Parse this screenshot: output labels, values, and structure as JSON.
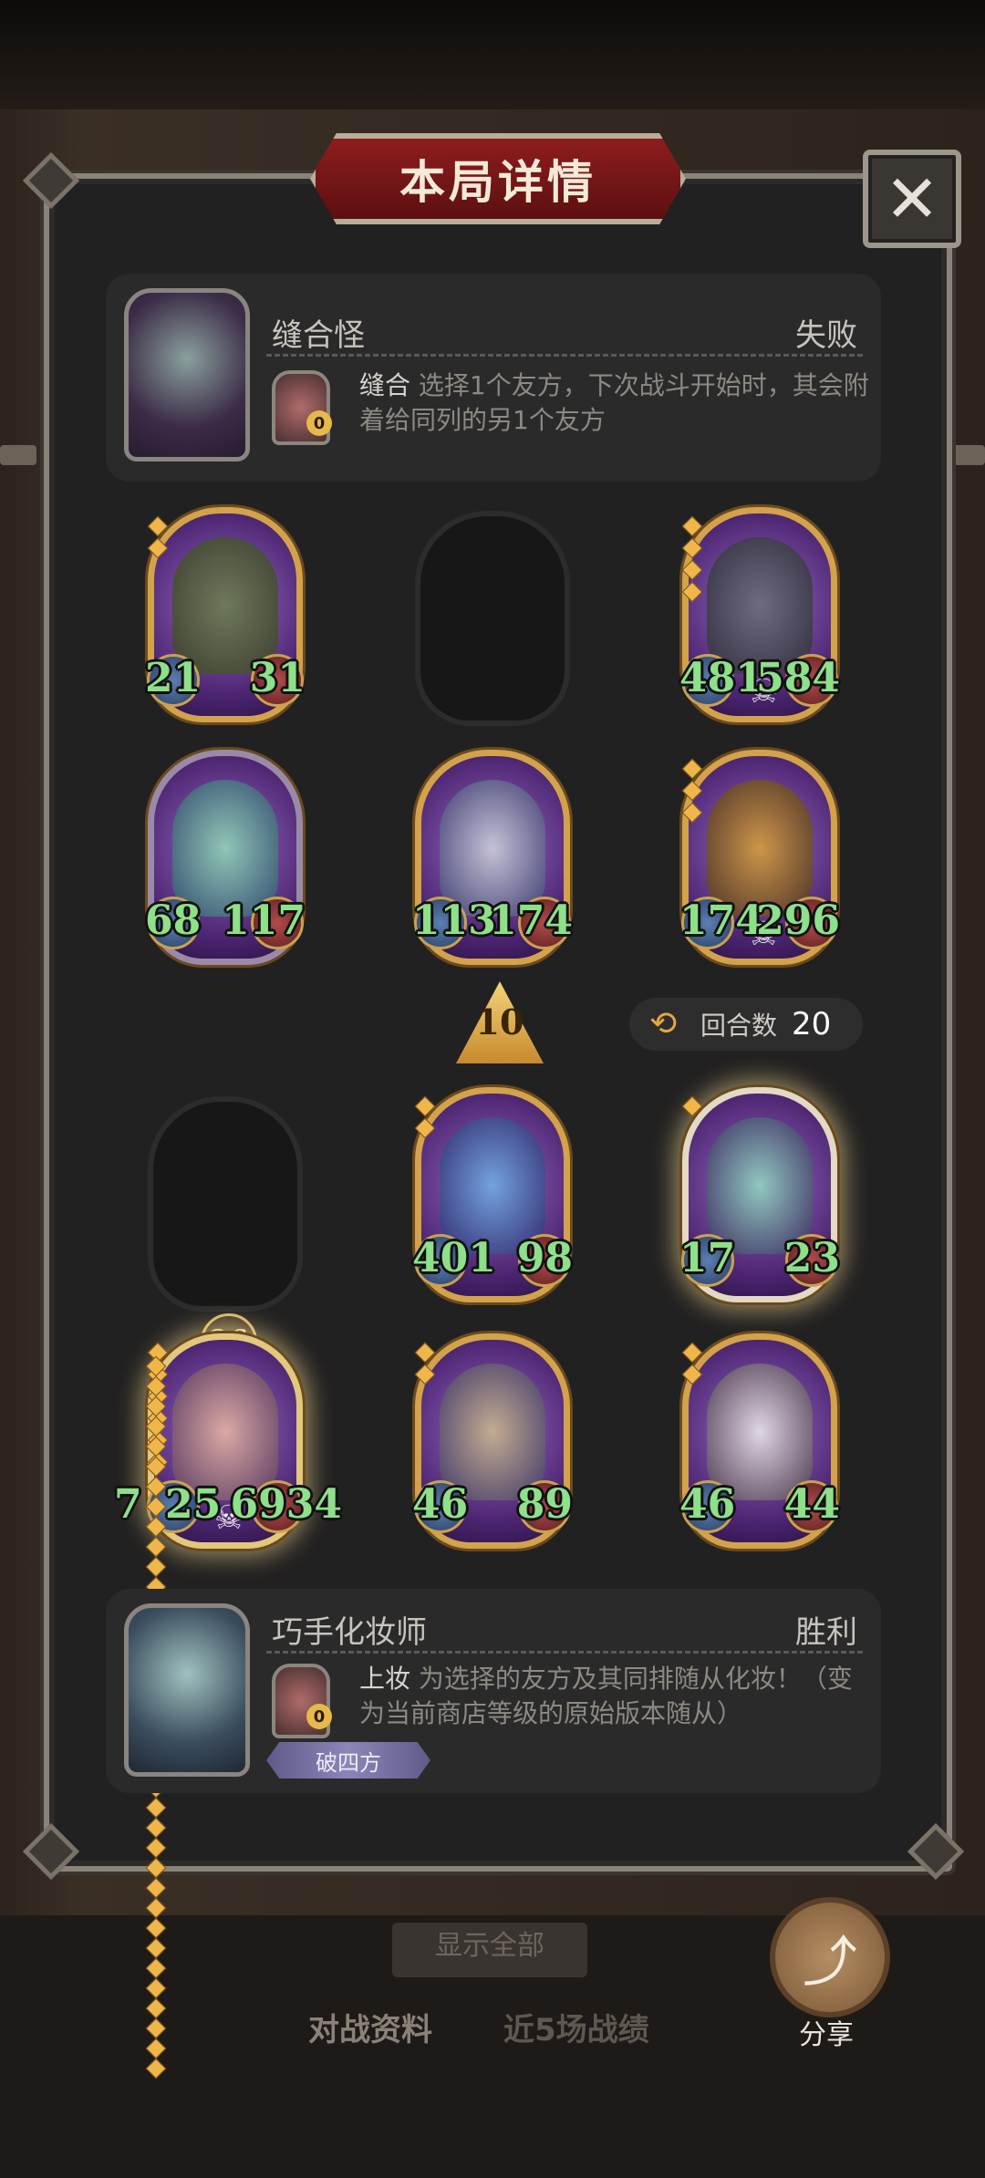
{
  "title": "本局详情",
  "close_label": "✕",
  "opponent": {
    "name": "缝合怪",
    "result": "失败",
    "hero_power_cost": "0",
    "power_name": "缝合",
    "power_desc": "选择1个友方，下次战斗开始时，其会附着给同列的另1个友方"
  },
  "player": {
    "name": "巧手化妆师",
    "result": "胜利",
    "hero_power_cost": "0",
    "power_name": "上妆",
    "power_desc": "为选择的友方及其同排随从化妆！（变为当前商店等级的原始版本随从）",
    "tag": "破四方"
  },
  "opponent_board": [
    {
      "attack": "21",
      "health": "31"
    },
    null,
    {
      "attack": "481",
      "health": "584"
    },
    {
      "attack": "68",
      "health": "117"
    },
    {
      "attack": "113",
      "health": "174"
    },
    {
      "attack": "174",
      "health": "296"
    }
  ],
  "player_board": [
    null,
    {
      "attack": "401",
      "health": "98"
    },
    {
      "attack": "17",
      "health": "23"
    },
    {
      "attack": "7",
      "health": "6934"
    },
    {
      "attack": "46",
      "health": "89"
    },
    {
      "attack": "46",
      "health": "44"
    }
  ],
  "center_stat": "25",
  "level": "10",
  "turn": {
    "label": "回合数",
    "value": "20"
  },
  "tier_badge": "26",
  "bottom": {
    "show_all": "显示全部",
    "tab_battle": "对战资料",
    "tab_recent": "近5场战绩",
    "share": "分享"
  }
}
